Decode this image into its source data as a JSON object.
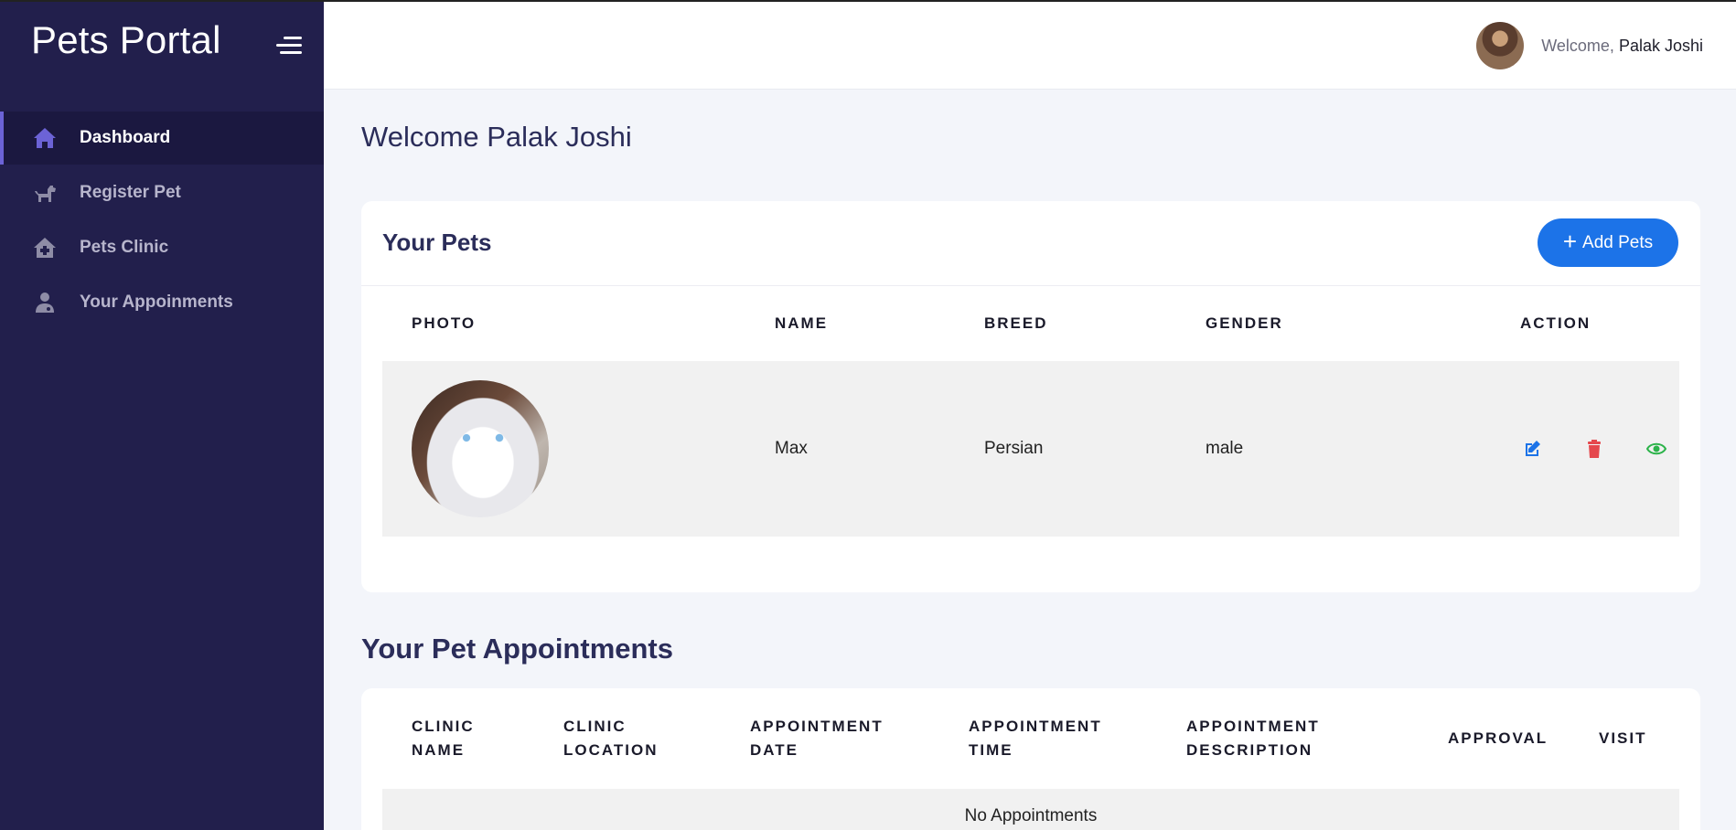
{
  "app": {
    "title": "Pets Portal"
  },
  "sidebar": {
    "items": [
      {
        "label": "Dashboard",
        "icon": "home-icon"
      },
      {
        "label": "Register Pet",
        "icon": "dog-icon"
      },
      {
        "label": "Pets Clinic",
        "icon": "clinic-icon"
      },
      {
        "label": "Your Appoinments",
        "icon": "doctor-icon"
      }
    ]
  },
  "header": {
    "welcome_prefix": "Welcome,",
    "user_name": "Palak Joshi"
  },
  "main": {
    "page_title": "Welcome Palak Joshi",
    "pets": {
      "title": "Your Pets",
      "add_button_icon": "+",
      "add_button_label": "Add Pets",
      "columns": [
        "PHOTO",
        "NAME",
        "BREED",
        "GENDER",
        "ACTION"
      ],
      "rows": [
        {
          "name": "Max",
          "breed": "Persian",
          "gender": "male"
        }
      ]
    },
    "appointments": {
      "title": "Your Pet Appointments",
      "columns": [
        [
          "CLINIC",
          "NAME"
        ],
        [
          "CLINIC",
          "LOCATION"
        ],
        [
          "APPOINTMENT",
          "DATE"
        ],
        [
          "APPOINTMENT",
          "TIME"
        ],
        [
          "APPOINTMENT",
          "DESCRIPTION"
        ],
        [
          "APPROVAL"
        ],
        [
          "VISIT"
        ]
      ],
      "empty_text": "No Appointments"
    }
  },
  "colors": {
    "sidebar_bg": "#221f4c",
    "accent": "#6c63d6",
    "primary_button": "#1c73e8",
    "edit_icon": "#1c73e8",
    "delete_icon": "#e5484d",
    "view_icon": "#2cb34a"
  }
}
